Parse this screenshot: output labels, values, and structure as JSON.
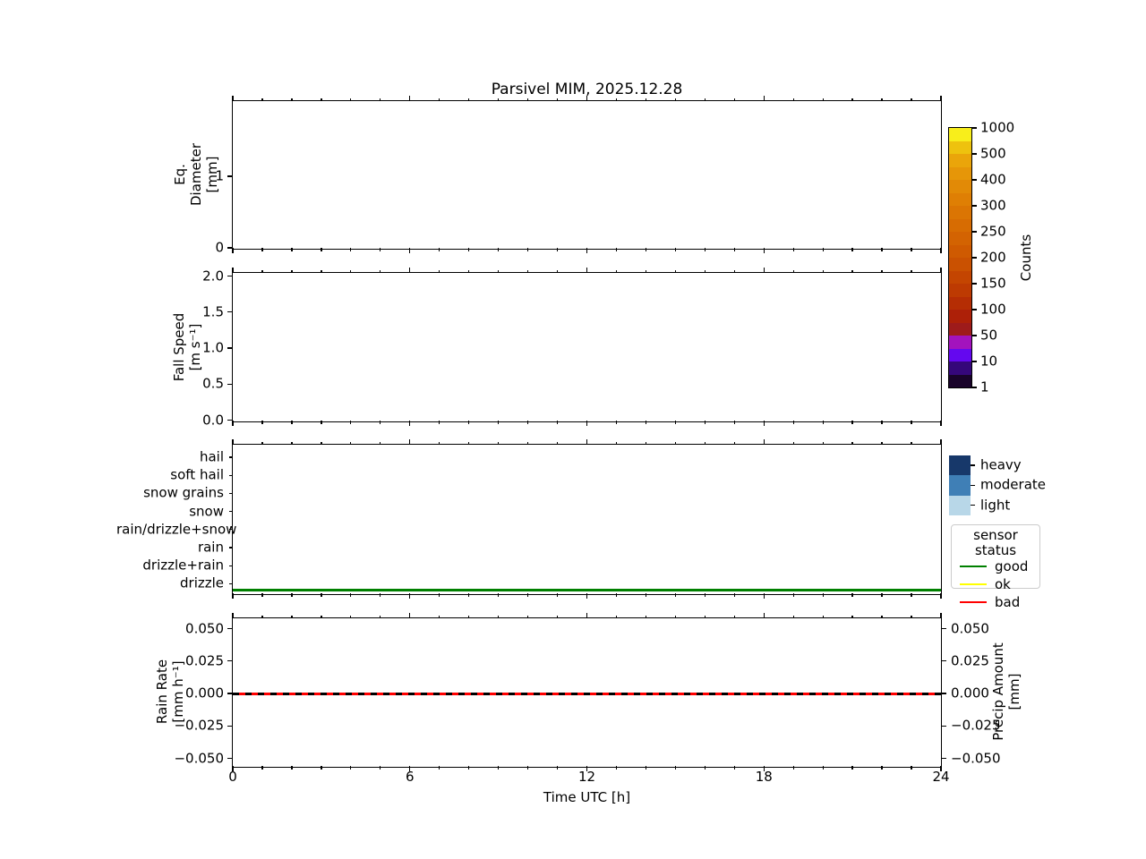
{
  "title": "Parsivel MIM, 2025.12.28",
  "xaxis": {
    "label": "Time UTC [h]",
    "ticks": [
      "0",
      "6",
      "12",
      "18",
      "24"
    ]
  },
  "subplots": {
    "eq_diameter": {
      "ylabel": "Eq.\nDiameter\n[mm]",
      "yticks": [
        "1",
        "0"
      ]
    },
    "fall_speed": {
      "ylabel": "Fall Speed\n[m s⁻¹]",
      "yticks": [
        "2.0",
        "1.5",
        "1.0",
        "0.5",
        "0.0"
      ]
    },
    "precip_type": {
      "categories": [
        "hail",
        "soft hail",
        "snow grains",
        "snow",
        "rain/drizzle+snow",
        "rain",
        "drizzle+rain",
        "drizzle"
      ],
      "line_color": "#008000"
    },
    "rain_rate": {
      "ylabel": "Rain Rate\n[mm h⁻¹]",
      "yticks": [
        "0.050",
        "0.025",
        "0.000",
        "−0.025",
        "−0.050"
      ],
      "right_label": "Precip Amount\n[mm]",
      "right_ticks": [
        "0.050",
        "0.025",
        "0.000",
        "−0.025",
        "−0.050"
      ],
      "line_color": "#ff0000",
      "dash_color": "#000000"
    }
  },
  "colorbar_counts": {
    "label": "Counts",
    "ticks": [
      "1000",
      "500",
      "400",
      "300",
      "250",
      "200",
      "150",
      "100",
      "50",
      "10",
      "1"
    ],
    "bands_top_to_bottom": [
      "#f8ee1b",
      "#eec20e",
      "#eaa50a",
      "#e69608",
      "#e28a06",
      "#df7f04",
      "#db7503",
      "#d76c02",
      "#d36302",
      "#cf5a01",
      "#ca5101",
      "#c44501",
      "#bd3a02",
      "#b52d04",
      "#ad2008",
      "#9e1b1b",
      "#a313bd",
      "#6408ef",
      "#35077a",
      "#19032a"
    ]
  },
  "colorbar_intensity": {
    "labels": [
      "heavy",
      "moderate",
      "light"
    ],
    "colors": [
      "#17386a",
      "#3f7fb6",
      "#b8d7e8"
    ]
  },
  "legend": {
    "title": "sensor status",
    "entries": [
      {
        "label": "good",
        "color": "#008000"
      },
      {
        "label": "ok",
        "color": "#ffff00"
      },
      {
        "label": "bad",
        "color": "#ff0000"
      }
    ]
  },
  "chart_data": [
    {
      "type": "heatmap",
      "title": "Parsivel MIM, 2025.12.28",
      "ylabel": "Eq. Diameter [mm]",
      "xlim": [
        0,
        24
      ],
      "yticks": [
        0,
        1
      ],
      "values": [],
      "colorbar": {
        "label": "Counts",
        "boundaries": [
          1,
          10,
          50,
          100,
          150,
          200,
          250,
          300,
          400,
          500,
          1000
        ]
      },
      "note": "panel empty - no counts recorded"
    },
    {
      "type": "heatmap",
      "ylabel": "Fall Speed [m s⁻¹]",
      "xlim": [
        0,
        24
      ],
      "ylim": [
        0.0,
        2.0
      ],
      "yticks": [
        0.0,
        0.5,
        1.0,
        1.5,
        2.0
      ],
      "values": [],
      "note": "panel empty - no counts recorded"
    },
    {
      "type": "line",
      "categories": [
        "drizzle",
        "drizzle+rain",
        "rain",
        "rain/drizzle+snow",
        "snow",
        "snow grains",
        "soft hail",
        "hail"
      ],
      "xlim": [
        0,
        24
      ],
      "series": [
        {
          "name": "sensor status",
          "value": "good",
          "color": "#008000",
          "x": [
            0,
            24
          ],
          "y": [
            0,
            0
          ]
        }
      ],
      "note": "flat green line at baseline below drizzle for full day"
    },
    {
      "type": "line",
      "ylabel": "Rain Rate [mm h⁻¹]",
      "ylabel_right": "Precip Amount [mm]",
      "xlabel": "Time UTC [h]",
      "xlim": [
        0,
        24
      ],
      "ylim": [
        -0.055,
        0.055
      ],
      "yticks": [
        -0.05,
        -0.025,
        0.0,
        0.025,
        0.05
      ],
      "series": [
        {
          "name": "Rain Rate",
          "color": "#ff0000",
          "style": "solid",
          "x": [
            0,
            24
          ],
          "y": [
            0.0,
            0.0
          ]
        },
        {
          "name": "Precip Amount",
          "color": "#000000",
          "style": "dashed",
          "x": [
            0,
            24
          ],
          "y": [
            0.0,
            0.0
          ]
        }
      ]
    }
  ]
}
